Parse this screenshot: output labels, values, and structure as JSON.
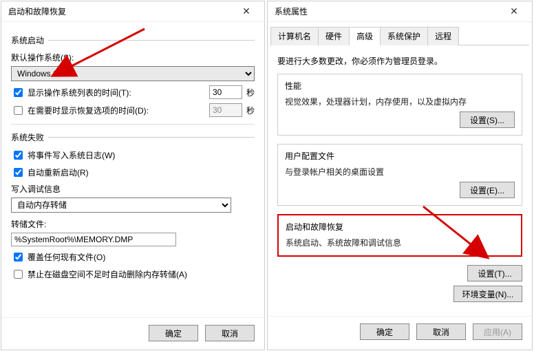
{
  "left_dialog": {
    "title": "启动和故障恢复",
    "section_startup": "系统启动",
    "default_os_label": "默认操作系统(S):",
    "os_selected": "Windows 10",
    "show_os_list_label": "显示操作系统列表的时间(T):",
    "show_os_list_time": "30",
    "show_recovery_label": "在需要时显示恢复选项的时间(D):",
    "show_recovery_time": "30",
    "seconds": "秒",
    "section_failure": "系统失败",
    "write_event_label": "将事件写入系统日志(W)",
    "auto_restart_label": "自动重新启动(R)",
    "debug_info_label": "写入调试信息",
    "debug_select": "自动内存转储",
    "dump_file_label": "转储文件:",
    "dump_file_value": "%SystemRoot%\\MEMORY.DMP",
    "overwrite_label": "覆盖任何现有文件(O)",
    "disable_autodelete_label": "禁止在磁盘空间不足时自动删除内存转储(A)",
    "ok": "确定",
    "cancel": "取消"
  },
  "right_dialog": {
    "title": "系统属性",
    "tabs": [
      "计算机名",
      "硬件",
      "高级",
      "系统保护",
      "远程"
    ],
    "active_tab_index": 2,
    "admin_note": "要进行大多数更改，你必须作为管理员登录。",
    "group_perf": {
      "title": "性能",
      "desc": "视觉效果，处理器计划，内存使用，以及虚拟内存",
      "button": "设置(S)..."
    },
    "group_userprof": {
      "title": "用户配置文件",
      "desc": "与登录帐户相关的桌面设置",
      "button": "设置(E)..."
    },
    "group_startup": {
      "title": "启动和故障恢复",
      "desc": "系统启动、系统故障和调试信息",
      "button": "设置(T)..."
    },
    "env_button": "环境变量(N)...",
    "ok": "确定",
    "cancel": "取消",
    "apply": "应用(A)"
  }
}
